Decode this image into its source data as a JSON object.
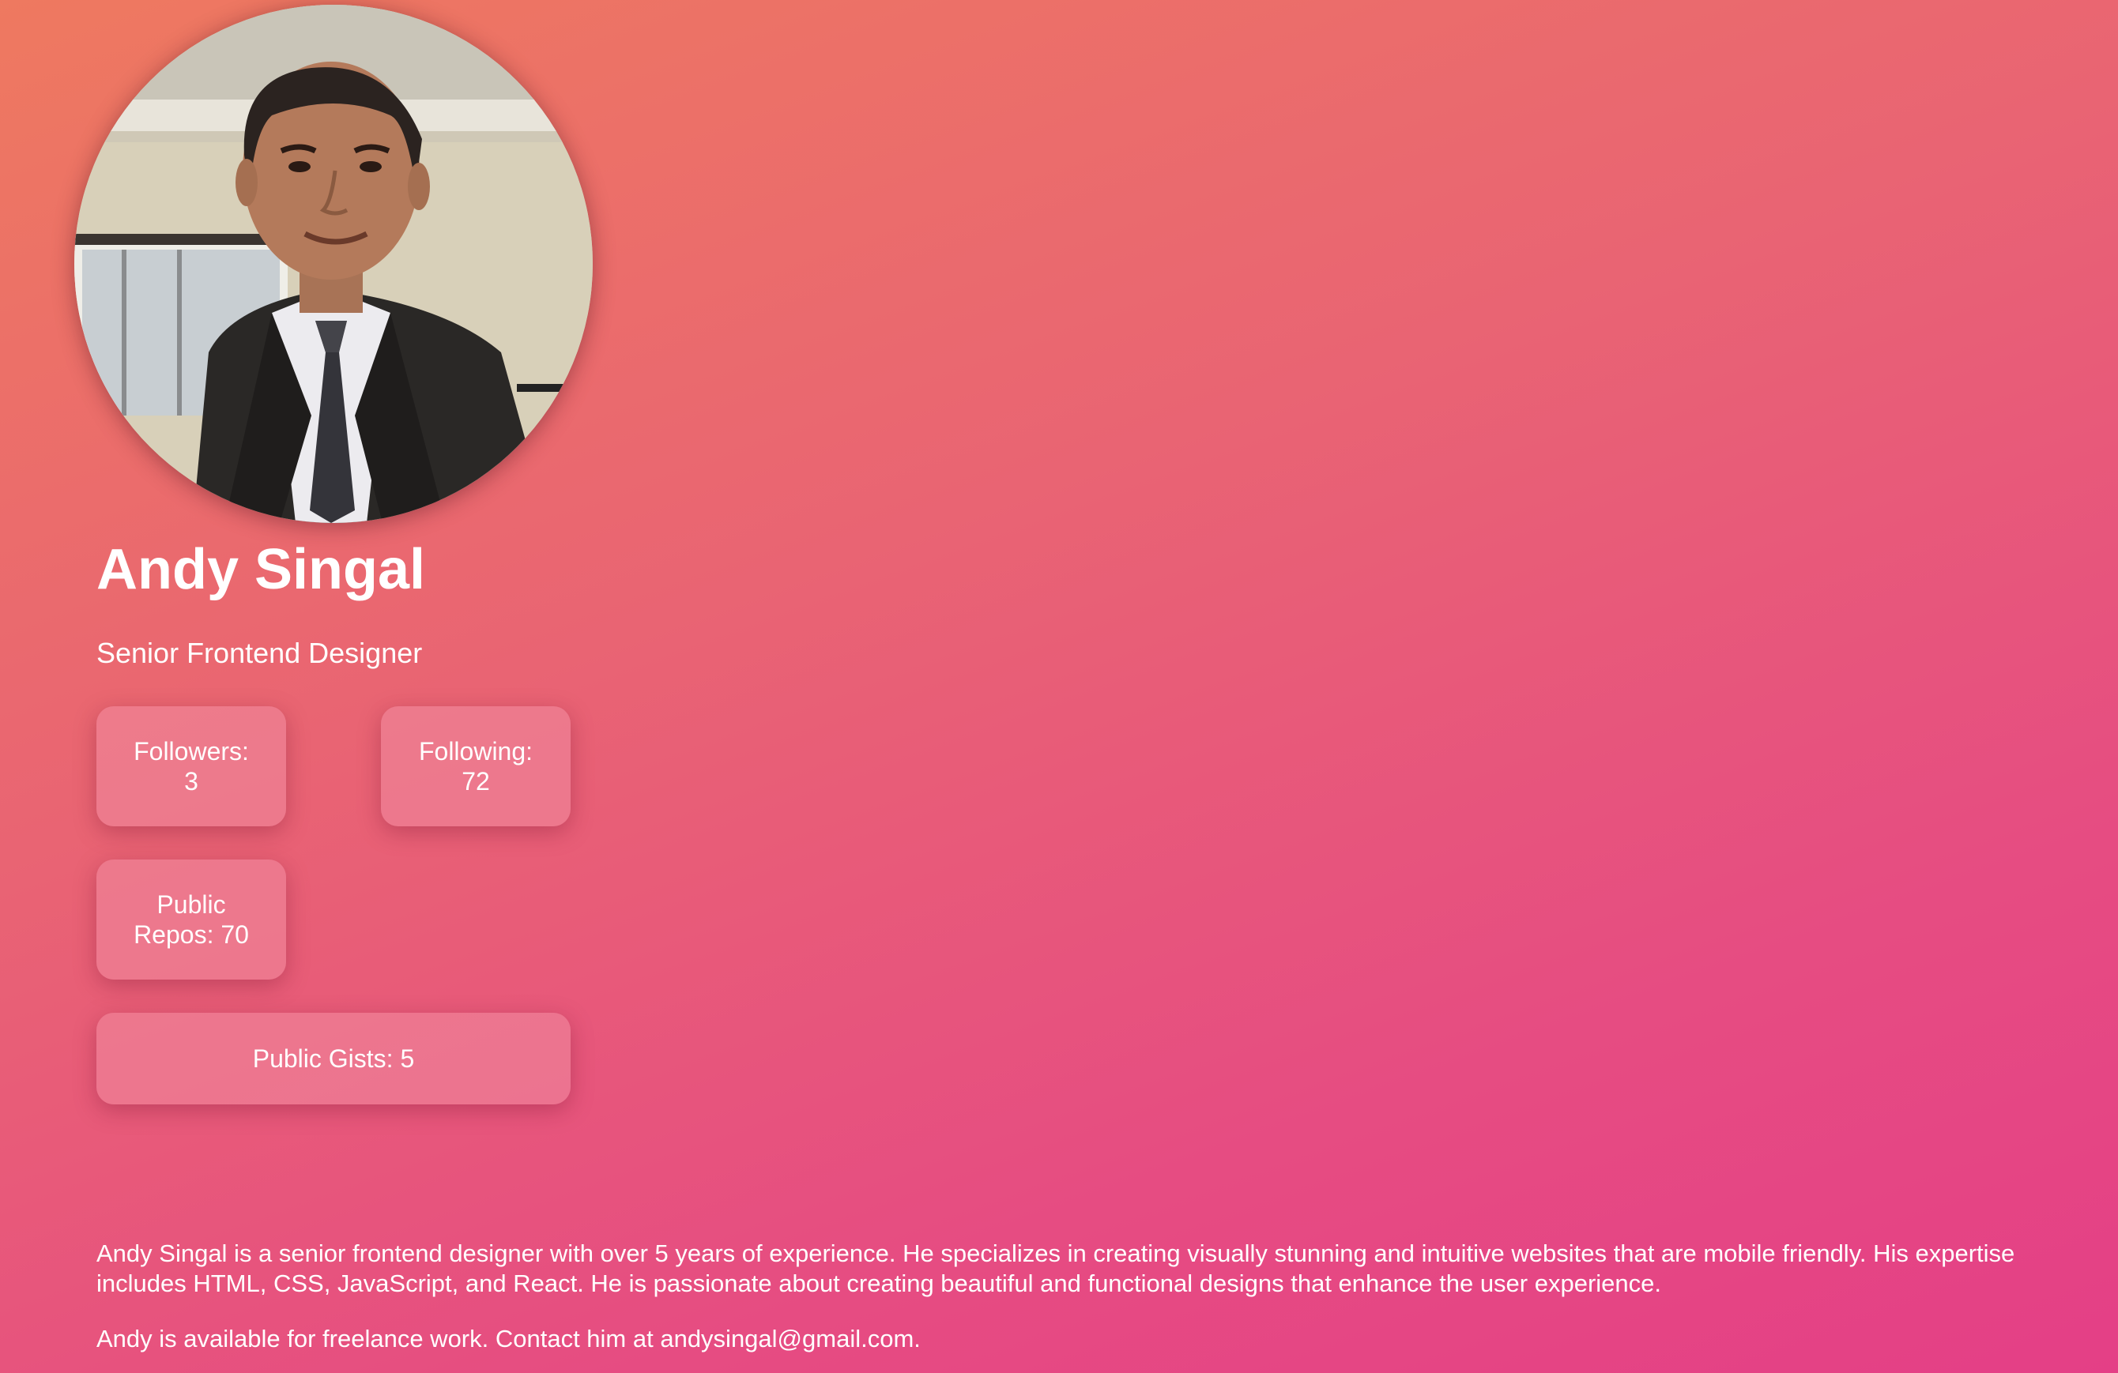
{
  "profile": {
    "name": "Andy Singal",
    "title": "Senior Frontend Designer",
    "avatar_icon": "profile-photo"
  },
  "stats": {
    "followers_label": "Followers:",
    "followers_value": "3",
    "following_label": "Following:",
    "following_value": "72",
    "repos_line1": "Public",
    "repos_line2": "Repos: 70",
    "gists": "Public Gists: 5"
  },
  "bio": {
    "description": "Andy Singal is a senior frontend designer with over 5 years of experience. He specializes in creating visually stunning and intuitive websites that are mobile friendly. His expertise includes HTML, CSS, JavaScript, and React. He is passionate about creating beautiful and functional designs that enhance the user experience.",
    "contact": "Andy is available for freelance work. Contact him at andysingal@gmail.com."
  },
  "colors": {
    "gradient_start": "#ee7960",
    "gradient_end": "#e43f86",
    "card_background": "#ef8ca0",
    "text": "#ffffff"
  }
}
